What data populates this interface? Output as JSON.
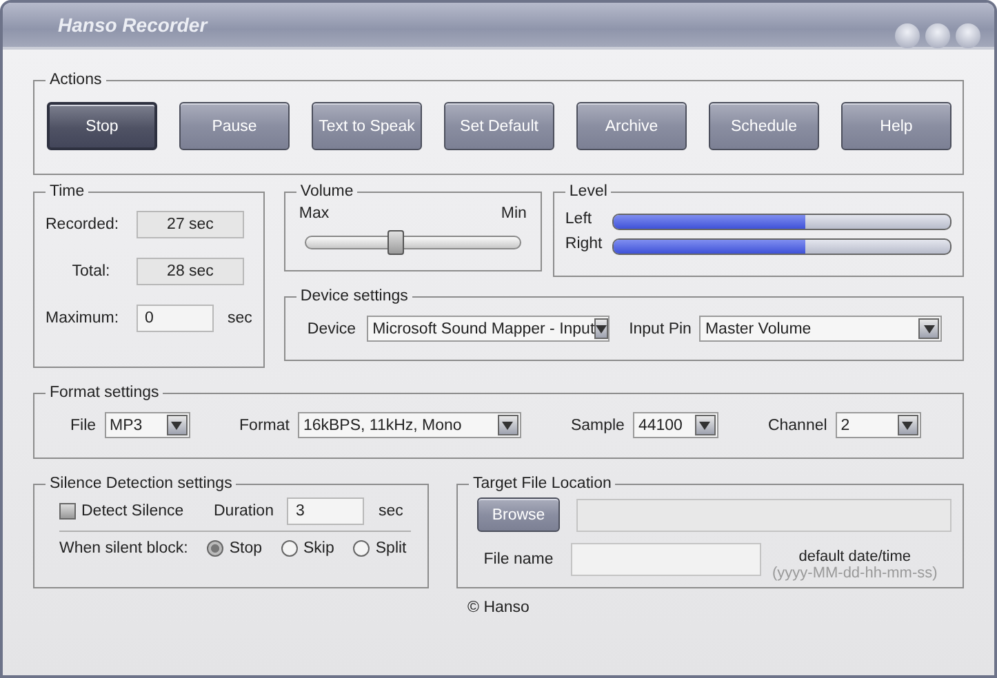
{
  "window": {
    "title": "Hanso Recorder"
  },
  "actions": {
    "label": "Actions",
    "buttons": [
      {
        "label": "Stop",
        "default": true
      },
      {
        "label": "Pause",
        "default": false
      },
      {
        "label": "Text to Speak",
        "default": false
      },
      {
        "label": "Set Default",
        "default": false
      },
      {
        "label": "Archive",
        "default": false
      },
      {
        "label": "Schedule",
        "default": false
      },
      {
        "label": "Help",
        "default": false
      }
    ]
  },
  "time": {
    "label": "Time",
    "recorded_label": "Recorded:",
    "recorded": "27 sec",
    "total_label": "Total:",
    "total": "28 sec",
    "maximum_label": "Maximum:",
    "maximum": "0",
    "unit": "sec"
  },
  "volume": {
    "label": "Volume",
    "max_label": "Max",
    "min_label": "Min",
    "level": 0.42
  },
  "levels": {
    "label": "Level",
    "channels": [
      {
        "name": "Left",
        "level": 0.57
      },
      {
        "name": "Right",
        "level": 0.57
      }
    ]
  },
  "device": {
    "label": "Device settings",
    "device_label": "Device",
    "device": "Microsoft Sound Mapper - Input",
    "pin_label": "Input Pin",
    "pin": "Master Volume"
  },
  "format": {
    "label": "Format settings",
    "fields": [
      {
        "label": "File",
        "value": "MP3"
      },
      {
        "label": "Format",
        "value": "16kBPS, 11kHz, Mono"
      },
      {
        "label": "Sample",
        "value": "44100"
      },
      {
        "label": "Channel",
        "value": "2"
      }
    ]
  },
  "silence": {
    "label": "Silence Detection settings",
    "detect_label": "Detect Silence",
    "checked": false,
    "duration_label": "Duration",
    "duration": "3",
    "unit": "sec",
    "block_label": "When silent block:",
    "options": [
      {
        "label": "Stop",
        "selected": true
      },
      {
        "label": "Skip",
        "selected": false
      },
      {
        "label": "Split",
        "selected": false
      }
    ]
  },
  "target": {
    "label": "Target File Location",
    "browse": "Browse",
    "filename_label": "File name",
    "hint": "default date/time",
    "pattern": "(yyyy-MM-dd-hh-mm-ss)"
  },
  "footer": "© Hanso"
}
